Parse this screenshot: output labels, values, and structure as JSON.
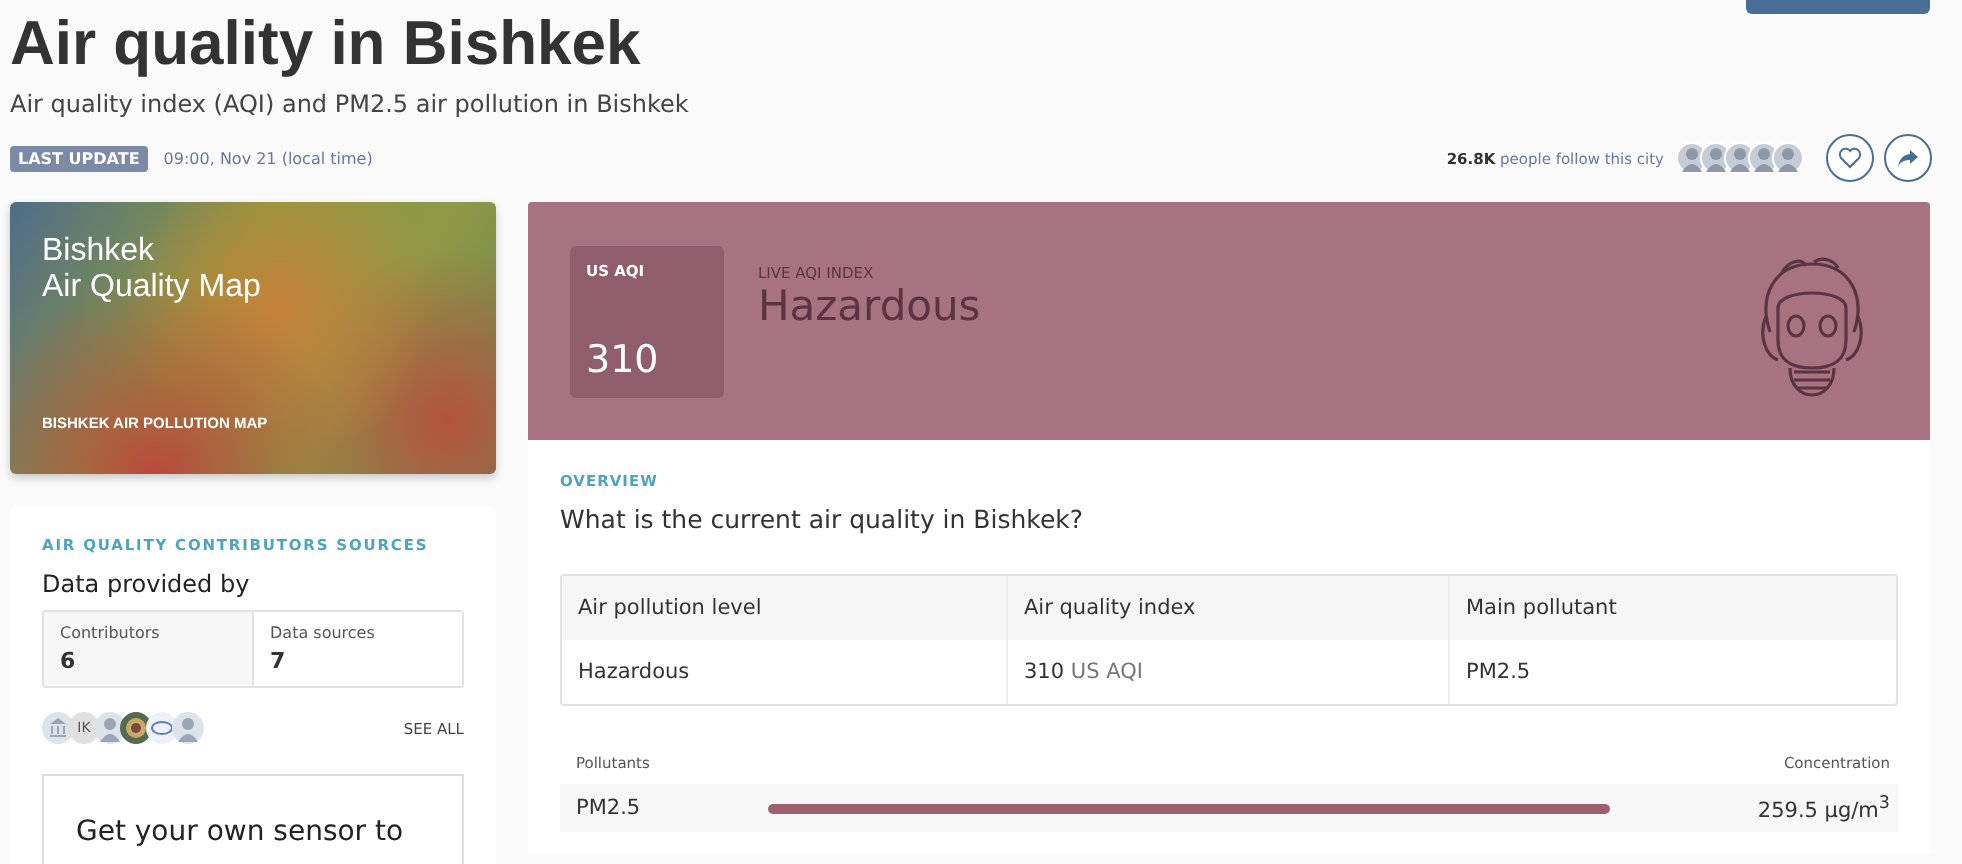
{
  "header": {
    "title": "Air quality in Bishkek",
    "subtitle": "Air quality index (AQI) and PM2.5 air pollution in Bishkek",
    "last_update_badge": "LAST UPDATE",
    "last_update_time": "09:00, Nov 21 (local time)",
    "followers_count": "26.8K",
    "followers_text": "people follow this city"
  },
  "map_card": {
    "title_line_1": "Bishkek",
    "title_line_2": "Air Quality Map",
    "link": "BISHKEK AIR POLLUTION MAP"
  },
  "contributors": {
    "heading": "AIR QUALITY CONTRIBUTORS SOURCES",
    "title": "Data provided by",
    "stats": [
      {
        "label": "Contributors",
        "value": "6"
      },
      {
        "label": "Data sources",
        "value": "7"
      }
    ],
    "avatars": [
      {
        "kind": "building"
      },
      {
        "kind": "initials",
        "text": "IK"
      },
      {
        "kind": "person"
      },
      {
        "kind": "emblem"
      },
      {
        "kind": "logo"
      },
      {
        "kind": "person"
      }
    ],
    "see_all": "SEE ALL",
    "sensor_promo": "Get your own sensor to"
  },
  "aqi_banner": {
    "badge_label": "US AQI",
    "value": "310",
    "caption": "LIVE AQI INDEX",
    "status": "Hazardous"
  },
  "overview": {
    "heading": "OVERVIEW",
    "question": "What is the current air quality in Bishkek?",
    "table": {
      "columns": [
        "Air pollution level",
        "Air quality index",
        "Main pollutant"
      ],
      "rows": [
        {
          "level": "Hazardous",
          "aqi_value": "310",
          "aqi_unit": "US AQI",
          "pollutant": "PM2.5"
        }
      ]
    },
    "pollutants": {
      "column_1": "Pollutants",
      "column_2": "Concentration",
      "rows": [
        {
          "name": "PM2.5",
          "level": 1.0,
          "reading": "259.5 µg/m$^{3}$"
        }
      ]
    }
  }
}
